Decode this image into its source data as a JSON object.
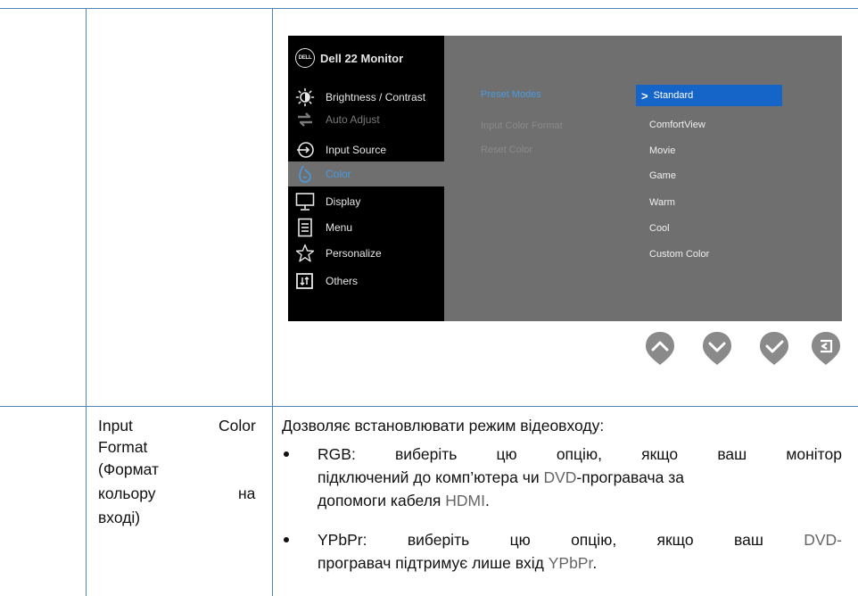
{
  "osd": {
    "title": "Dell 22 Monitor",
    "logo_text": "DELL",
    "menu": [
      {
        "label": "Brightness / Contrast",
        "icon": "brightness-icon",
        "state": "normal"
      },
      {
        "label": "Auto Adjust",
        "icon": "auto-adjust-icon",
        "state": "dim"
      },
      {
        "label": "Input Source",
        "icon": "input-source-icon",
        "state": "normal"
      },
      {
        "label": "Color",
        "icon": "color-icon",
        "state": "selected"
      },
      {
        "label": "Display",
        "icon": "display-icon",
        "state": "normal"
      },
      {
        "label": "Menu",
        "icon": "menu-icon",
        "state": "normal"
      },
      {
        "label": "Personalize",
        "icon": "personalize-star-icon",
        "state": "normal"
      },
      {
        "label": "Others",
        "icon": "others-icon",
        "state": "normal"
      }
    ],
    "submenu": [
      "Preset Modes",
      "Input Color Format",
      "Reset Color"
    ],
    "options": [
      "Standard",
      "ComfortView",
      "Movie",
      "Game",
      "Warm",
      "Cool",
      "Custom Color"
    ],
    "selected_marker": ">",
    "colors": {
      "accent_blue": "#4a9ae0",
      "selected_bg": "#1565c8",
      "panel_gray": "#6f6f6f",
      "nav_button": "#8a8a8a"
    },
    "nav_buttons": [
      "up-arrow-icon",
      "down-arrow-icon",
      "check-icon",
      "back-icon"
    ]
  },
  "row2": {
    "label_line1_left": "Input",
    "label_line1_right": "Color",
    "label_line2": "Format",
    "label_line3": "(Формат",
    "label_line4_left": "кольору",
    "label_line4_right": "на",
    "label_line5": "вході)",
    "intro": "Дозволяє встановлювати режим відеовходу:",
    "bullets": [
      {
        "term": "RGB",
        "line1_parts": [
          "RGB",
          ":",
          "виберіть",
          "цю",
          "опцію,",
          "якщо",
          "ваш",
          "монітор"
        ],
        "line2_pre": "підключений до комп’ютера чи ",
        "line2_gray": "DVD",
        "line2_post": "-програвача за",
        "line3_pre": "допомоги кабеля ",
        "line3_gray": "HDMI",
        "line3_post": "."
      },
      {
        "term": "YPbPr",
        "line1_parts": [
          "YPbPr",
          ":",
          "виберіть",
          "цю",
          "опцію,",
          "якщо",
          "ваш",
          "DVD-"
        ],
        "line2_pre": "програвач підтримує лише вхід ",
        "line2_gray": "YPbPr",
        "line2_post": "."
      }
    ]
  }
}
